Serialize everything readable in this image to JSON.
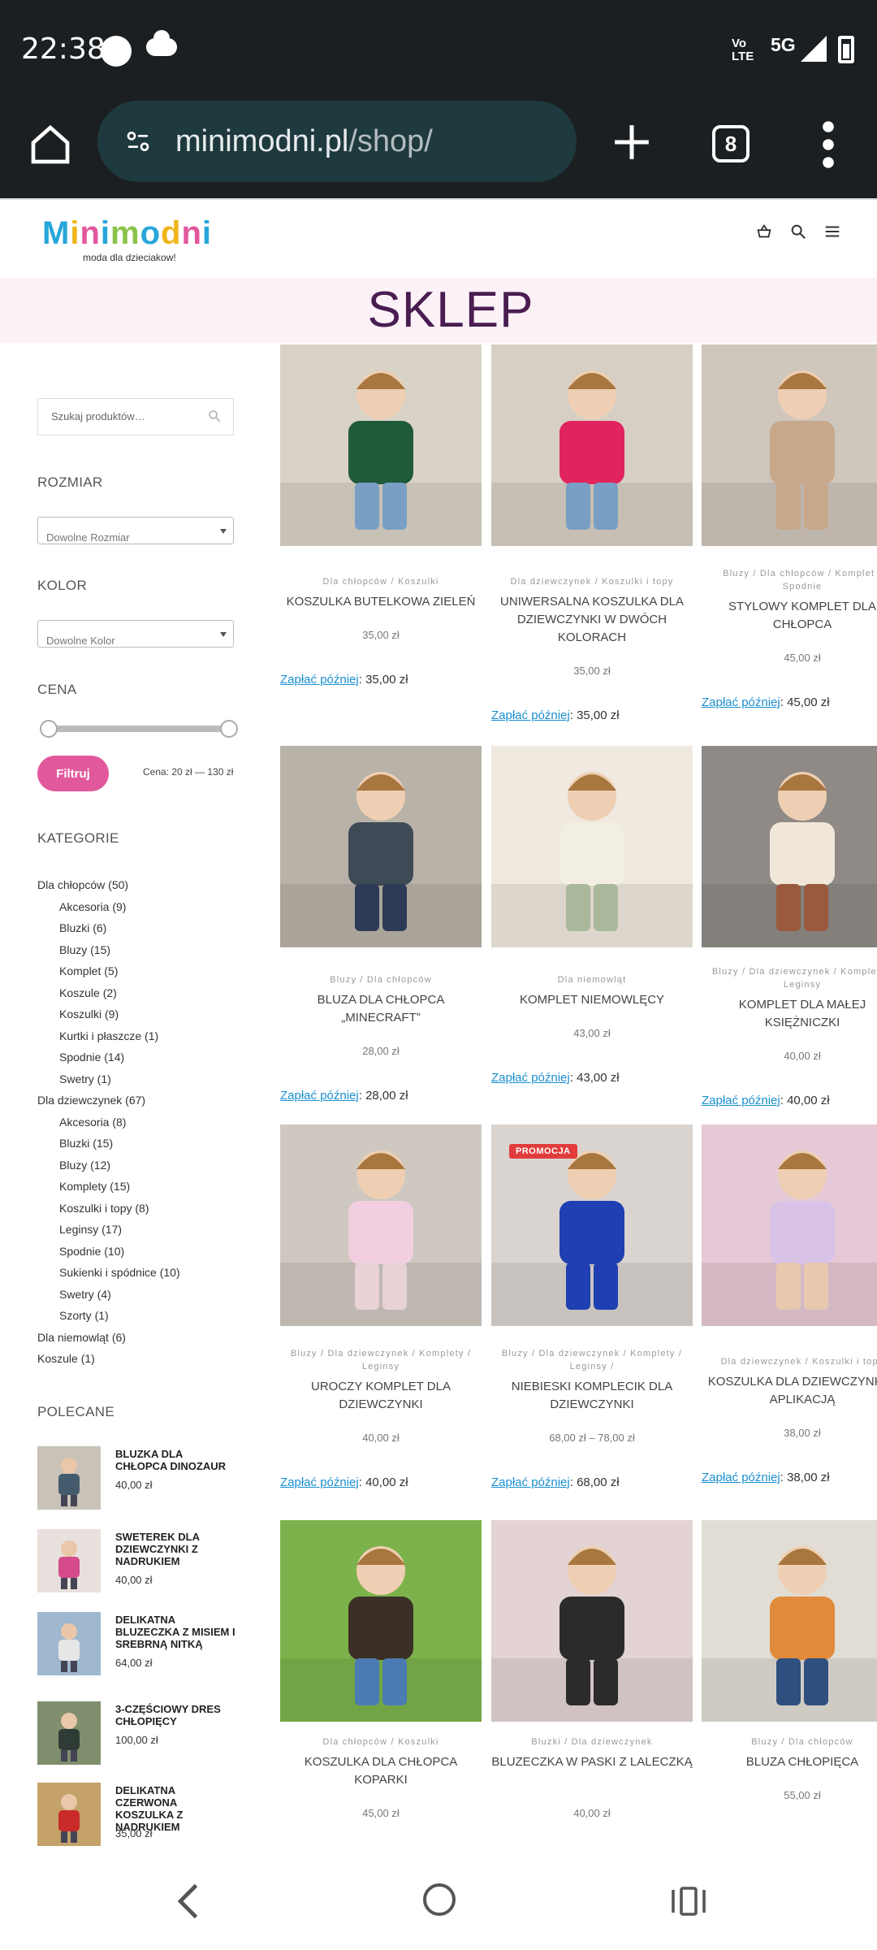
{
  "status_bar": {
    "time": "22:38",
    "network_label": "Vo⁠\nLTE",
    "volte": "Vo",
    "lte": "LTE",
    "signal_type": "5G"
  },
  "browser": {
    "url_host": "minimodni.pl",
    "url_path": "/shop/",
    "tab_count": "8"
  },
  "site": {
    "logo_text": "Minimodni",
    "tagline": "moda dla dzieciakow!"
  },
  "page_title": "SKLEP",
  "sidebar": {
    "search_placeholder": "Szukaj produktów…",
    "size_heading": "ROZMIAR",
    "size_select": "Dowolne Rozmiar",
    "color_heading": "KOLOR",
    "color_select": "Dowolne Kolor",
    "price_heading": "CENA",
    "filter_button": "Filtruj",
    "price_range": "Cena: 20 zł — 130 zł",
    "categories_heading": "KATEGORIE",
    "categories": [
      {
        "label": "Dla chłopców (50)",
        "level": 0
      },
      {
        "label": "Akcesoria (9)",
        "level": 1
      },
      {
        "label": "Bluzki (6)",
        "level": 1
      },
      {
        "label": "Bluzy (15)",
        "level": 1
      },
      {
        "label": "Komplet (5)",
        "level": 1
      },
      {
        "label": "Koszule (2)",
        "level": 1
      },
      {
        "label": "Koszulki (9)",
        "level": 1
      },
      {
        "label": "Kurtki i płaszcze (1)",
        "level": 1
      },
      {
        "label": "Spodnie (14)",
        "level": 1
      },
      {
        "label": "Swetry (1)",
        "level": 1
      },
      {
        "label": "Dla dziewczynek (67)",
        "level": 0
      },
      {
        "label": "Akcesoria (8)",
        "level": 1
      },
      {
        "label": "Bluzki (15)",
        "level": 1
      },
      {
        "label": "Bluzy (12)",
        "level": 1
      },
      {
        "label": "Komplety (15)",
        "level": 1
      },
      {
        "label": "Koszulki i topy (8)",
        "level": 1
      },
      {
        "label": "Leginsy (17)",
        "level": 1
      },
      {
        "label": "Spodnie (10)",
        "level": 1
      },
      {
        "label": "Sukienki i spódnice (10)",
        "level": 1
      },
      {
        "label": "Swetry (4)",
        "level": 1
      },
      {
        "label": "Szorty (1)",
        "level": 1
      },
      {
        "label": "Dla niemowląt (6)",
        "level": 0
      },
      {
        "label": "Koszule (1)",
        "level": 0
      }
    ],
    "featured_heading": "POLECANE",
    "featured": [
      {
        "name": "BLUZKA DLA CHŁOPCA DINOZAUR",
        "price": "40,00 zł"
      },
      {
        "name": "SWETEREK DLA DZIEWCZYNKI Z NADRUKIEM",
        "price": "40,00 zł"
      },
      {
        "name": "DELIKATNA BLUZECZKA Z MISIEM I SREBRNĄ NITKĄ",
        "price": "64,00 zł"
      },
      {
        "name": "3-CZĘŚCIOWY DRES CHŁOPIĘCY",
        "price": "100,00 zł"
      },
      {
        "name": "DELIKATNA CZERWONA KOSZULKA Z NADRUKIEM",
        "price": "35,00 zł"
      }
    ]
  },
  "pay_later_label": "Zapłać później",
  "products": [
    {
      "cat": "Dla chłopców / Koszulki",
      "title": "KOSZULKA BUTELKOWA ZIELEŃ",
      "price": "35,00 zł",
      "pay": ": 35,00 zł"
    },
    {
      "cat": "Dla dziewczynek / Koszulki i topy",
      "title": "UNIWERSALNA KOSZULKA DLA DZIEWCZYNKI W DWÓCH KOLORACH",
      "price": "35,00 zł",
      "pay": ": 35,00 zł"
    },
    {
      "cat": "Bluzy / Dla chłopców / Komplet / Spodnie",
      "title": "STYLOWY KOMPLET DLA CHŁOPCA",
      "price": "45,00 zł",
      "pay": ": 45,00 zł"
    },
    {
      "cat": "Bluzy / Dla chłopców",
      "title": "BLUZA DLA CHŁOPCA „MINECRAFT”",
      "price": "28,00 zł",
      "pay": ": 28,00 zł"
    },
    {
      "cat": "Dla niemowląt",
      "title": "KOMPLET NIEMOWLĘCY",
      "price": "43,00 zł",
      "pay": ": 43,00 zł"
    },
    {
      "cat": "Bluzy / Dla dziewczynek / Komplety / Leginsy",
      "title": "KOMPLET DLA MAŁEJ KSIĘŻNICZKI",
      "price": "40,00 zł",
      "pay": ": 40,00 zł"
    },
    {
      "cat": "Bluzy / Dla dziewczynek / Komplety / Leginsy",
      "title": "UROCZY KOMPLET DLA DZIEWCZYNKI",
      "price": "40,00 zł",
      "pay": ": 40,00 zł"
    },
    {
      "cat": "Bluzy / Dla dziewczynek / Komplety / Leginsy /",
      "title": "NIEBIESKI KOMPLECIK DLA DZIEWCZYNKI",
      "price": "68,00 zł – 78,00 zł",
      "pay": ": 68,00 zł",
      "badge": "PROMOCJA"
    },
    {
      "cat": "Dla dziewczynek / Koszulki i topy",
      "title": "KOSZULKA DLA DZIEWCZYNKI Z APLIKACJĄ",
      "price": "38,00 zł",
      "pay": ": 38,00 zł"
    },
    {
      "cat": "Dla chłopców / Koszulki",
      "title": "KOSZULKA DLA CHŁOPCA KOPARKI",
      "price": "45,00 zł",
      "pay": ""
    },
    {
      "cat": "Bluzki / Dla dziewczynek",
      "title": "BLUZECZKA W PASKI Z LALECZKĄ",
      "price": "40,00 zł",
      "pay": ""
    },
    {
      "cat": "Bluzy / Dla chłopców",
      "title": "BLUZA CHŁOPIĘCA",
      "price": "55,00 zł",
      "pay": ""
    }
  ],
  "colors": {
    "accent_pink": "#e2589d",
    "title_purple": "#4a1d52",
    "link_blue": "#1a8fd0",
    "hero_bg": "#fcf1f7"
  },
  "icons": [
    "home-icon",
    "tune-icon",
    "plus-icon",
    "tabs-icon",
    "more-vert-icon",
    "cart-icon",
    "search-icon",
    "menu-icon",
    "back-icon",
    "home-nav-icon",
    "recents-icon"
  ]
}
